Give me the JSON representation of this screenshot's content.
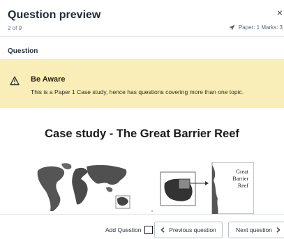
{
  "header": {
    "title": "Question preview",
    "counter": "2 of 9",
    "close_symbol": "×",
    "paper_info": "Paper: 1 Marks: 3"
  },
  "question": {
    "label": "Question"
  },
  "alert": {
    "title": "Be Aware",
    "text": "This is a Paper 1 Case study, hence has questions covering more than one topic.",
    "background": "#f9eeb7"
  },
  "content": {
    "case_title": "Case study - The Great Barrier Reef",
    "figure_label_line1": "Great",
    "figure_label_line2": "Barrier",
    "figure_label_line3": "Reef"
  },
  "footer": {
    "add_question_label": "Add Question",
    "prev_label": "Previous question",
    "next_label": "Next question"
  },
  "icons": {
    "close": "close-icon",
    "paper": "send-icon",
    "alert": "warning-icon",
    "prev": "chevron-left-icon",
    "next": "chevron-right-icon"
  }
}
